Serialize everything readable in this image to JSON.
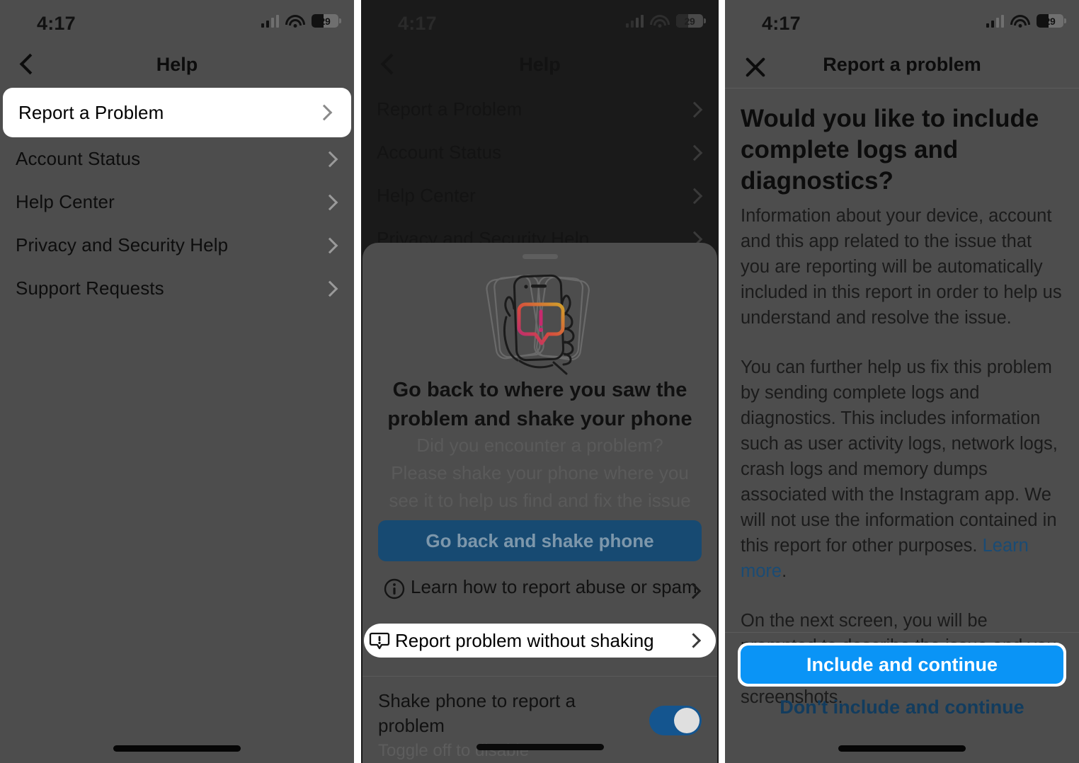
{
  "colors": {
    "panel_bg": "#4d4d4d",
    "panel2_bg": "#1a1a1a",
    "accent_blue": "#0a94f6",
    "dim_blue_cta": "#174a72",
    "link_blue": "#1a4b74",
    "toggle_on": "#14558f",
    "highlight_white": "#ffffff"
  },
  "status_bar": {
    "time": "4:17",
    "battery_percent": "29",
    "signal_icon": "cellular-signal-icon",
    "wifi_icon": "wifi-icon",
    "battery_icon": "battery-charging-icon"
  },
  "panel1": {
    "nav": {
      "title": "Help",
      "back_icon": "chevron-left-icon"
    },
    "rows": [
      {
        "label": "Report a Problem",
        "highlighted": true
      },
      {
        "label": "Account Status",
        "highlighted": false
      },
      {
        "label": "Help Center",
        "highlighted": false
      },
      {
        "label": "Privacy and Security Help",
        "highlighted": false
      },
      {
        "label": "Support Requests",
        "highlighted": false
      }
    ]
  },
  "panel2": {
    "nav": {
      "title": "Help",
      "back_icon": "chevron-left-icon"
    },
    "rows": [
      {
        "label": "Report a Problem"
      },
      {
        "label": "Account Status"
      },
      {
        "label": "Help Center"
      },
      {
        "label": "Privacy and Security Help"
      }
    ],
    "sheet": {
      "illustration": "hand-shaking-phone-illustration",
      "title": "Go back to where you saw the problem and shake your phone",
      "subtitle": "Did you encounter a problem? Please shake your phone where you see it to help us find and fix the issue faster.",
      "primary_button": "Go back and shake phone",
      "options": [
        {
          "label": "Learn how to report abuse or spam",
          "icon": "info-circle-icon",
          "highlighted": false
        },
        {
          "label": "Report problem without shaking",
          "icon": "exclamation-bubble-icon",
          "highlighted": true
        }
      ],
      "toggle": {
        "label": "Shake phone to report a problem",
        "sublabel": "Toggle off to disable",
        "state": "on"
      }
    }
  },
  "panel3": {
    "nav": {
      "title": "Report a problem",
      "close_icon": "close-x-icon"
    },
    "heading": "Would you like to include complete logs and diagnostics?",
    "paragraphs": [
      "Information about your device, account and this app related to the issue that you are reporting will be automatically included in this report in order to help us understand and resolve the issue.",
      "You can further help us fix this problem by sending complete logs and diagnostics. This includes information such as user activity logs, network logs, crash logs and memory dumps associated with the Instagram app. We will not use the information contained in this report for other purposes. ",
      "On the next screen, you will be prompted to describe the issue and you may also choose to attach additional screenshots."
    ],
    "learn_more_link": "Learn more",
    "learn_more_suffix": ".",
    "include_button": "Include and continue",
    "dont_include_button": "Don't include and continue"
  }
}
